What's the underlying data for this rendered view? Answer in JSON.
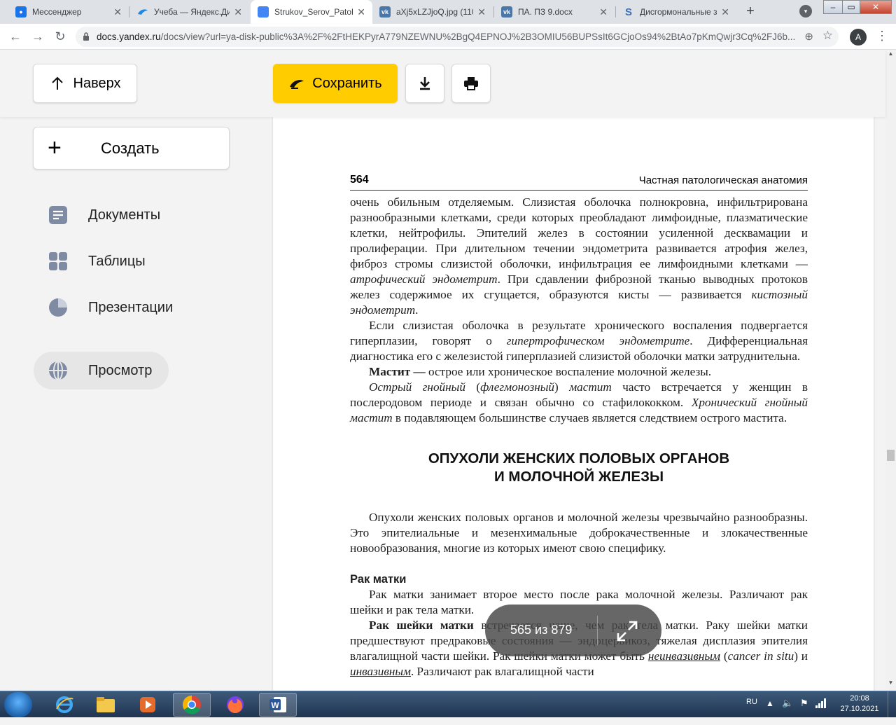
{
  "browser": {
    "tabs": [
      {
        "title": "Мессенджер",
        "color": "#1a73e8",
        "active": false
      },
      {
        "title": "Учеба — Яндекс.Ди",
        "color": "#1e88e5",
        "active": false
      },
      {
        "title": "Strukov_Serov_Patol",
        "color": "#4285f4",
        "active": true
      },
      {
        "title": "aXj5xLZJjoQ.jpg (110",
        "color": "#4a76a8",
        "active": false
      },
      {
        "title": "ПА. ПЗ 9.docx",
        "color": "#4a76a8",
        "active": false
      },
      {
        "title": "Дисгормональные з",
        "color": "#3b6fb6",
        "active": false
      }
    ],
    "new_tab": "+",
    "url_host": "docs.yandex.ru",
    "url_path": "/docs/view?url=ya-disk-public%3A%2F%2FtHEKPyrA779NZEWNU%2BgQ4EPNOJ%2B3OMIU56BUPSsIt6GCjoOs94%2BtAo7pKmQwjr3Cq%2FJ6b...",
    "profile_initial": "A"
  },
  "toolbar": {
    "up_label": "Наверх",
    "save_label": "Сохранить"
  },
  "sidebar": {
    "create_label": "Создать",
    "items": [
      {
        "label": "Документы",
        "icon": "document-icon"
      },
      {
        "label": "Таблицы",
        "icon": "table-icon"
      },
      {
        "label": "Презентации",
        "icon": "presentation-icon"
      },
      {
        "label": "Просмотр",
        "icon": "globe-icon",
        "selected": true
      }
    ]
  },
  "document": {
    "page_number": "564",
    "running_head": "Частная патологическая анатомия",
    "p1": {
      "a": "очень обильным отделяемым. Слизистая оболочка полнокровна, инфильтрирована разнообразными клетками, среди которых преобладают лимфоидные, плазматические клетки, нейтрофилы. Эпителий желез в состоянии усиленной десквамации и пролиферации. При длительном течении эндометрита развивается атрофия желез, фиброз стромы слизистой оболочки, инфильтрация ее лимфоидными клетками — ",
      "b": "атрофический эндометрит",
      "c": ". При сдавлении фиброзной тканью выводных протоков желез содержимое их сгущается, образуются кисты — развивается ",
      "d": "кистозный эндометрит",
      "e": "."
    },
    "p2": {
      "a": "Если слизистая оболочка в результате хронического воспаления подвергается гиперплазии, говорят о ",
      "b": "гипертрофическом эндометрите",
      "c": ". Дифференциальная диагностика его с железистой гиперплазией слизистой оболочки матки затруднительна."
    },
    "p3": {
      "a": "Мастит —",
      "b": " острое или хроническое воспаление молочной железы."
    },
    "p4": {
      "a": "Острый гнойный",
      "b": " (",
      "c": "флегмонозный",
      "d": ") ",
      "e": "мастит",
      "f": " часто встречается у женщин в послеродовом периоде и связан обычно со стафилококком. ",
      "g": "Хронический гнойный мастит",
      "h": " в подавляющем большинстве случаев является следствием острого мастита."
    },
    "section_title_1": "ОПУХОЛИ ЖЕНСКИХ ПОЛОВЫХ ОРГАНОВ",
    "section_title_2": "И МОЛОЧНОЙ ЖЕЛЕЗЫ",
    "p5": "Опухоли женских половых органов и молочной железы чрезвычайно разнообразны. Это эпителиальные и мезенхимальные доброкачественные и злокачественные новообразования, многие из которых имеют свою специфику.",
    "subheading": "Рак матки",
    "p6": "Рак матки занимает второе место после рака молочной железы. Различают рак шейки и рак тела матки.",
    "p7": {
      "a": "Рак шейки матки",
      "b": " встречается чаще, чем рак тела матки. Раку шейки матки предшествуют предраковые состояния — эндоцервикоз, тяжелая дисплазия эпителия влагалищной части шейки. Рак шейки матки может быть ",
      "c": "неинвазивным",
      "d": " (",
      "e": "cancer in situ",
      "f": ") и ",
      "g": "инвазивным",
      "h": ". Различают рак влагалищной части"
    }
  },
  "pager": {
    "label": "565 из 879",
    "current": 565,
    "total": 879
  },
  "taskbar": {
    "lang": "RU",
    "time": "20:08",
    "date": "27.10.2021"
  },
  "colors": {
    "accent_yellow": "#ffcc00",
    "page_bg": "#f3f3f3"
  }
}
